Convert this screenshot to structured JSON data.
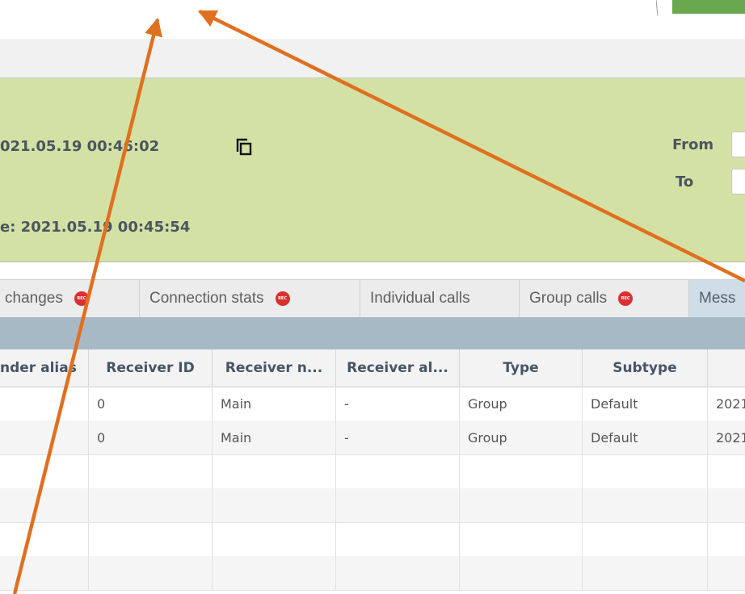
{
  "colors": {
    "info_panel_bg": "#d4e1a5",
    "tab_active_bg": "#cfdde6",
    "rec_badge": "#d93030",
    "annotation_arrow": "#e0701f"
  },
  "info_panel": {
    "line1": "021.05.19 00:46:02",
    "line2": "e: 2021.05.19 00:45:54",
    "copy_icon": "copy-icon",
    "from_label": "From",
    "to_label": "To"
  },
  "tabs": [
    {
      "label": "changes",
      "rec": true
    },
    {
      "label": "Connection stats",
      "rec": true
    },
    {
      "label": "Individual calls",
      "rec": false
    },
    {
      "label": "Group calls",
      "rec": true
    },
    {
      "label": "Mess",
      "rec": false,
      "active": true
    }
  ],
  "rec_text": "REC",
  "table": {
    "columns": [
      "nder alias",
      "Receiver ID",
      "Receiver n...",
      "Receiver al...",
      "Type",
      "Subtype",
      ""
    ],
    "rows": [
      [
        "",
        "0",
        "Main",
        "-",
        "Group",
        "Default",
        "2021"
      ],
      [
        "",
        "0",
        "Main",
        "-",
        "Group",
        "Default",
        "2021"
      ],
      [
        "",
        "",
        "",
        "",
        "",
        "",
        ""
      ],
      [
        "",
        "",
        "",
        "",
        "",
        "",
        ""
      ],
      [
        "",
        "",
        "",
        "",
        "",
        "",
        ""
      ],
      [
        "",
        "",
        "",
        "",
        "",
        "",
        ""
      ]
    ]
  }
}
